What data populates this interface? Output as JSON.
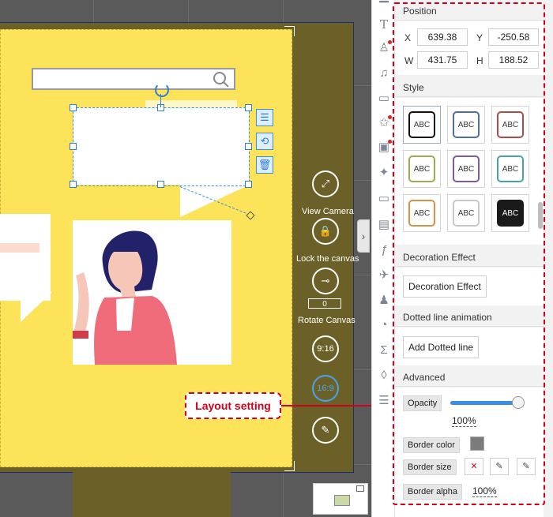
{
  "canvas": {
    "right_bar": {
      "view_camera_label": "View Camera",
      "lock_canvas_label": "Lock the canvas",
      "rotate_canvas_label": "Rotate Canvas",
      "rotate_value": "0",
      "ratio_916_label": "9:16",
      "ratio_169_label": "16:9"
    },
    "callout_label": "Layout setting"
  },
  "toolbar": {
    "icons": [
      "text-icon",
      "character-icon",
      "music-icon",
      "chat-icon",
      "image-star-icon",
      "image-icon",
      "magic-wand-icon",
      "folder-icon",
      "film-icon",
      "formula-icon",
      "airplane-icon",
      "person-icon",
      "pie-chart-icon",
      "sigma-icon",
      "drop-icon",
      "layers-icon"
    ]
  },
  "panel": {
    "position": {
      "title": "Position",
      "x_label": "X",
      "x_value": "639.38",
      "y_label": "Y",
      "y_value": "-250.58",
      "w_label": "W",
      "w_value": "431.75",
      "h_label": "H",
      "h_value": "188.52"
    },
    "style": {
      "title": "Style",
      "swatches": [
        {
          "text": "ABC",
          "border": "#111111",
          "fill": "#ffffff"
        },
        {
          "text": "ABC",
          "border": "#4a6ea9",
          "fill": "#ffffff"
        },
        {
          "text": "ABC",
          "border": "#b24a4a",
          "fill": "#ffffff"
        },
        {
          "text": "ABC",
          "border": "#9aab55",
          "fill": "#ffffff"
        },
        {
          "text": "ABC",
          "border": "#7b5aa6",
          "fill": "#ffffff"
        },
        {
          "text": "ABC",
          "border": "#49a3a3",
          "fill": "#ffffff"
        },
        {
          "text": "ABC",
          "border": "#d6914a",
          "fill": "#ffffff"
        },
        {
          "text": "ABC",
          "border": "#c8c8c8",
          "fill": "#ffffff"
        },
        {
          "text": "ABC",
          "border": "#1a1a1a",
          "fill": "#1a1a1a"
        }
      ]
    },
    "decoration": {
      "title": "Decoration Effect",
      "button": "Decoration Effect"
    },
    "dotted": {
      "title": "Dotted line animation",
      "button": "Add Dotted line"
    },
    "advanced": {
      "title": "Advanced",
      "opacity_label": "Opacity",
      "opacity_value": "100%",
      "opacity_level": 1.0,
      "border_color_label": "Border color",
      "border_size_label": "Border size",
      "border_alpha_label": "Border alpha",
      "border_alpha_value": "100%"
    }
  },
  "colors": {
    "accent": "#d0021b",
    "selection": "#3a8ee6",
    "stage": "#fde35a",
    "slider": "#3a8ee6"
  }
}
